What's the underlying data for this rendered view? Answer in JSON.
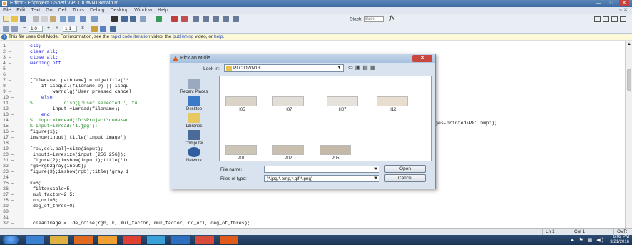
{
  "window": {
    "title": "Editor - E:\\project 1\\Sheri V\\PLCIOWN13\\main.m",
    "minimize": "—",
    "maximize": "□",
    "close": "✕"
  },
  "menu": [
    "File",
    "Edit",
    "Text",
    "Go",
    "Cell",
    "Tools",
    "Debug",
    "Desktop",
    "Window",
    "Help"
  ],
  "menu_right": "↘ ✕",
  "toolbar": {
    "stack_label": "Stack:",
    "stack_value": "Base",
    "fx_label": "fx",
    "cell_minus": "−",
    "cell_value1": "1.0",
    "cell_plus": "+",
    "cell_div": "÷",
    "cell_value2": "1.1",
    "cell_times": "×"
  },
  "infobar": {
    "prefix": "This file uses Cell Mode. For information, see the ",
    "link1": "rapid code iteration",
    "middle": " video, the ",
    "link2": "publishing",
    "middle2": " video, or ",
    "link3": "help",
    "suffix": "."
  },
  "code_lines": [
    {
      "n": "1 —",
      "text": "clc;",
      "style": "kw"
    },
    {
      "n": "2 —",
      "text": "clear all;",
      "style": "kw"
    },
    {
      "n": "3 —",
      "text": "close all;",
      "style": "kw"
    },
    {
      "n": "4 —",
      "text": "warning off",
      "style": "kw"
    },
    {
      "n": "5",
      "text": "",
      "style": ""
    },
    {
      "n": "6",
      "text": "",
      "style": ""
    },
    {
      "n": "7 —",
      "text": "[filename, pathname] = uigetfile('*",
      "style": ""
    },
    {
      "n": "8 —",
      "text": "    if isequal(filename,0) || isequ",
      "style": ""
    },
    {
      "n": "9 —",
      "text": "        warndlg('User pressed cancel",
      "style": ""
    },
    {
      "n": "10 —",
      "text": "    else",
      "style": "kw"
    },
    {
      "n": "11",
      "text": "%           disp(['User selected ', fu",
      "style": "cm"
    },
    {
      "n": "12 —",
      "text": "        input =imread(filename);",
      "style": ""
    },
    {
      "n": "13 —",
      "text": "    end",
      "style": "kw"
    },
    {
      "n": "14",
      "text": "%  input=imread('D:\\Project\\code\\an",
      "style": "cm"
    },
    {
      "n": "15",
      "text": "% input=imread('1.jpg');",
      "style": "cm"
    },
    {
      "n": "16 —",
      "text": "figure(1);",
      "style": ""
    },
    {
      "n": "17 —",
      "text": "imshow(input);title('input image')",
      "style": ""
    },
    {
      "n": "18",
      "text": "",
      "style": ""
    },
    {
      "n": "19 —",
      "text": "[row,col,pal]=size(input);",
      "style": "ul"
    },
    {
      "n": "20 —",
      "text": " input1=imresize(input,[256 256]);",
      "style": ""
    },
    {
      "n": "21 —",
      "text": " figure(2);imshow(input1);title('in",
      "style": ""
    },
    {
      "n": "22 —",
      "text": "rgb=rgb2gray(input);",
      "style": ""
    },
    {
      "n": "23 —",
      "text": "figure(3);imshow(rgb);title('gray i",
      "style": ""
    },
    {
      "n": "24",
      "text": "",
      "style": ""
    },
    {
      "n": "25 —",
      "text": "k=6;",
      "style": ""
    },
    {
      "n": "26 —",
      "text": " filterscale=5;",
      "style": ""
    },
    {
      "n": "27 —",
      "text": " mul_factor=2.5;",
      "style": ""
    },
    {
      "n": "28 —",
      "text": " no_ori=6;",
      "style": ""
    },
    {
      "n": "29 —",
      "text": " deg_of_thres=0;",
      "style": ""
    },
    {
      "n": "30",
      "text": "",
      "style": ""
    },
    {
      "n": "31",
      "text": "",
      "style": ""
    },
    {
      "n": "32 —",
      "text": " cleanimage =  de_noise(rgb, k, mul_factor, mul_factor, no_ori, deg_of_thres);",
      "style": ""
    }
  ],
  "code_overflow": "ges-printed\\P01.bmp');",
  "dialog": {
    "title": "Pick an M-file",
    "look_in_label": "Look in:",
    "look_in_value": "PLCIOWN13",
    "places": [
      "Recent Places",
      "Desktop",
      "Libraries",
      "Computer",
      "Network"
    ],
    "files_row1": [
      "H05",
      "H07",
      "H07",
      "H12"
    ],
    "files_row2": [
      "P01",
      "P02",
      "P05"
    ],
    "file_name_label": "File name:",
    "file_name_value": "",
    "file_type_label": "Files of type:",
    "file_type_value": "(*.jpg,*.bmp,*.gif,*.png)",
    "open_label": "Open",
    "cancel_label": "Cancel"
  },
  "status": {
    "ln": "Ln  1",
    "col": "Col  1",
    "ovr": "OVR"
  },
  "clock": {
    "time": "6:02 PM",
    "date": "3/21/2016"
  }
}
